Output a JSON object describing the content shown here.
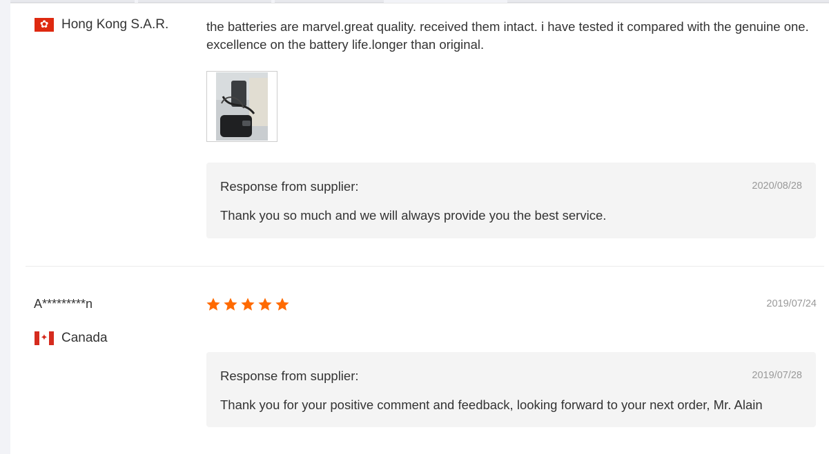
{
  "reviews": [
    {
      "country": "Hong Kong S.A.R.",
      "comment": "the batteries are marvel.great quality. received them intact. i have tested it compared with the genuine one. excellence on the battery life.longer than original.",
      "response": {
        "title": "Response from supplier:",
        "date": "2020/08/28",
        "text": "Thank you so much and we will always provide you the best service."
      }
    },
    {
      "user": "A*********n",
      "country": "Canada",
      "rating": 5,
      "date": "2019/07/24",
      "response": {
        "title": "Response from supplier:",
        "date": "2019/07/28",
        "text": "Thank you for your positive comment and feedback, looking forward to your next order, Mr. Alain"
      }
    }
  ],
  "colors": {
    "star": "#ff6a00",
    "flag_hk": "#de2910",
    "flag_ca": "#d52b1e"
  },
  "icons": {
    "hk_flag": "hong-kong-flag-icon",
    "ca_flag": "canada-flag-icon",
    "star": "star-icon"
  }
}
